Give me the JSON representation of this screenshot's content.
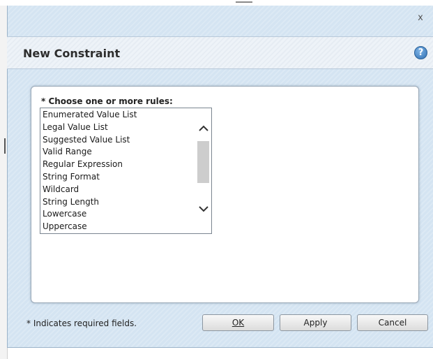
{
  "dialog": {
    "close_glyph": "x",
    "title": "New Constraint",
    "help_glyph": "?"
  },
  "rules": {
    "label": "* Choose one or more rules:",
    "items": [
      "Enumerated Value List",
      "Legal Value List",
      "Suggested Value List",
      "Valid Range",
      "Regular Expression",
      "String Format",
      "Wildcard",
      "String Length",
      "Lowercase",
      "Uppercase"
    ],
    "scroll_up_icon": "chevron-up-icon",
    "scroll_down_icon": "chevron-down-icon"
  },
  "footer": {
    "required_note": "* Indicates required fields.",
    "ok_label": "OK",
    "apply_label": "Apply",
    "cancel_label": "Cancel"
  },
  "colors": {
    "dialog_background": "#d4e4f2",
    "title_bar_background": "#eef3f8",
    "help_icon_blue": "#2f6fb3"
  }
}
